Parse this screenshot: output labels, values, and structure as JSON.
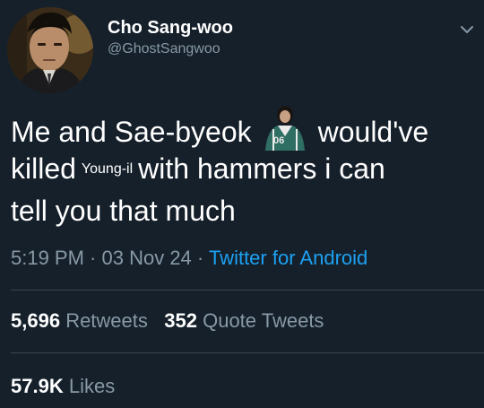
{
  "author": {
    "display_name": "Cho Sang-woo",
    "handle": "@GhostSangwoo"
  },
  "tweet": {
    "line1_a": "Me and Sae-byeok",
    "line1_b": "would've",
    "line2_a": "killed",
    "line2_small": "Young-il",
    "line2_b": "with hammers i can",
    "line3": "tell you that much",
    "inline_image_jersey": "06"
  },
  "meta": {
    "time": "5:19 PM",
    "sep1": " · ",
    "date": "03 Nov 24",
    "sep2": " · ",
    "source": "Twitter for Android"
  },
  "stats": {
    "retweets_count": "5,696",
    "retweets_label": "Retweets",
    "quotes_count": "352",
    "quotes_label": "Quote Tweets",
    "likes_count": "57.9K",
    "likes_label": "Likes"
  },
  "colors": {
    "background": "#15202b",
    "secondary_text": "#8899a6",
    "link": "#1da1f2",
    "divider": "#38444d"
  },
  "icons": {
    "menu": "chevron-down-icon"
  }
}
